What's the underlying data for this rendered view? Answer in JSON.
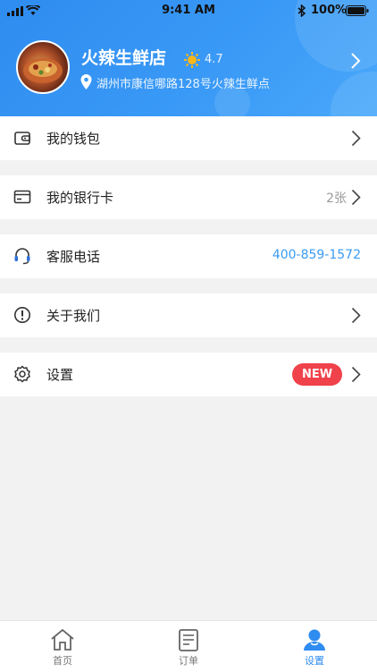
{
  "status_bar": {
    "time": "9:41 AM",
    "battery": "100%"
  },
  "store": {
    "name": "火辣生鲜店",
    "rating": "4.7",
    "address": "湖州市康信哪路128号火辣生鲜点"
  },
  "menu": {
    "wallet": {
      "label": "我的钱包",
      "icon": "wallet-icon"
    },
    "bank_card": {
      "label": "我的银行卡",
      "count": "2张",
      "icon": "card-icon"
    },
    "service": {
      "label": "客服电话",
      "phone": "400-859-1572",
      "icon": "headset-icon"
    },
    "about": {
      "label": "关于我们",
      "icon": "info-icon"
    },
    "settings": {
      "label": "设置",
      "badge": "NEW",
      "icon": "gear-icon"
    }
  },
  "tabbar": {
    "home": {
      "label": "首页",
      "icon": "home-icon"
    },
    "orders": {
      "label": "订单",
      "icon": "order-icon"
    },
    "settings": {
      "label": "设置",
      "icon": "user-icon"
    }
  },
  "colors": {
    "accent": "#2f8cf0",
    "badge": "#f0424a",
    "phone": "#3a9bf2"
  }
}
